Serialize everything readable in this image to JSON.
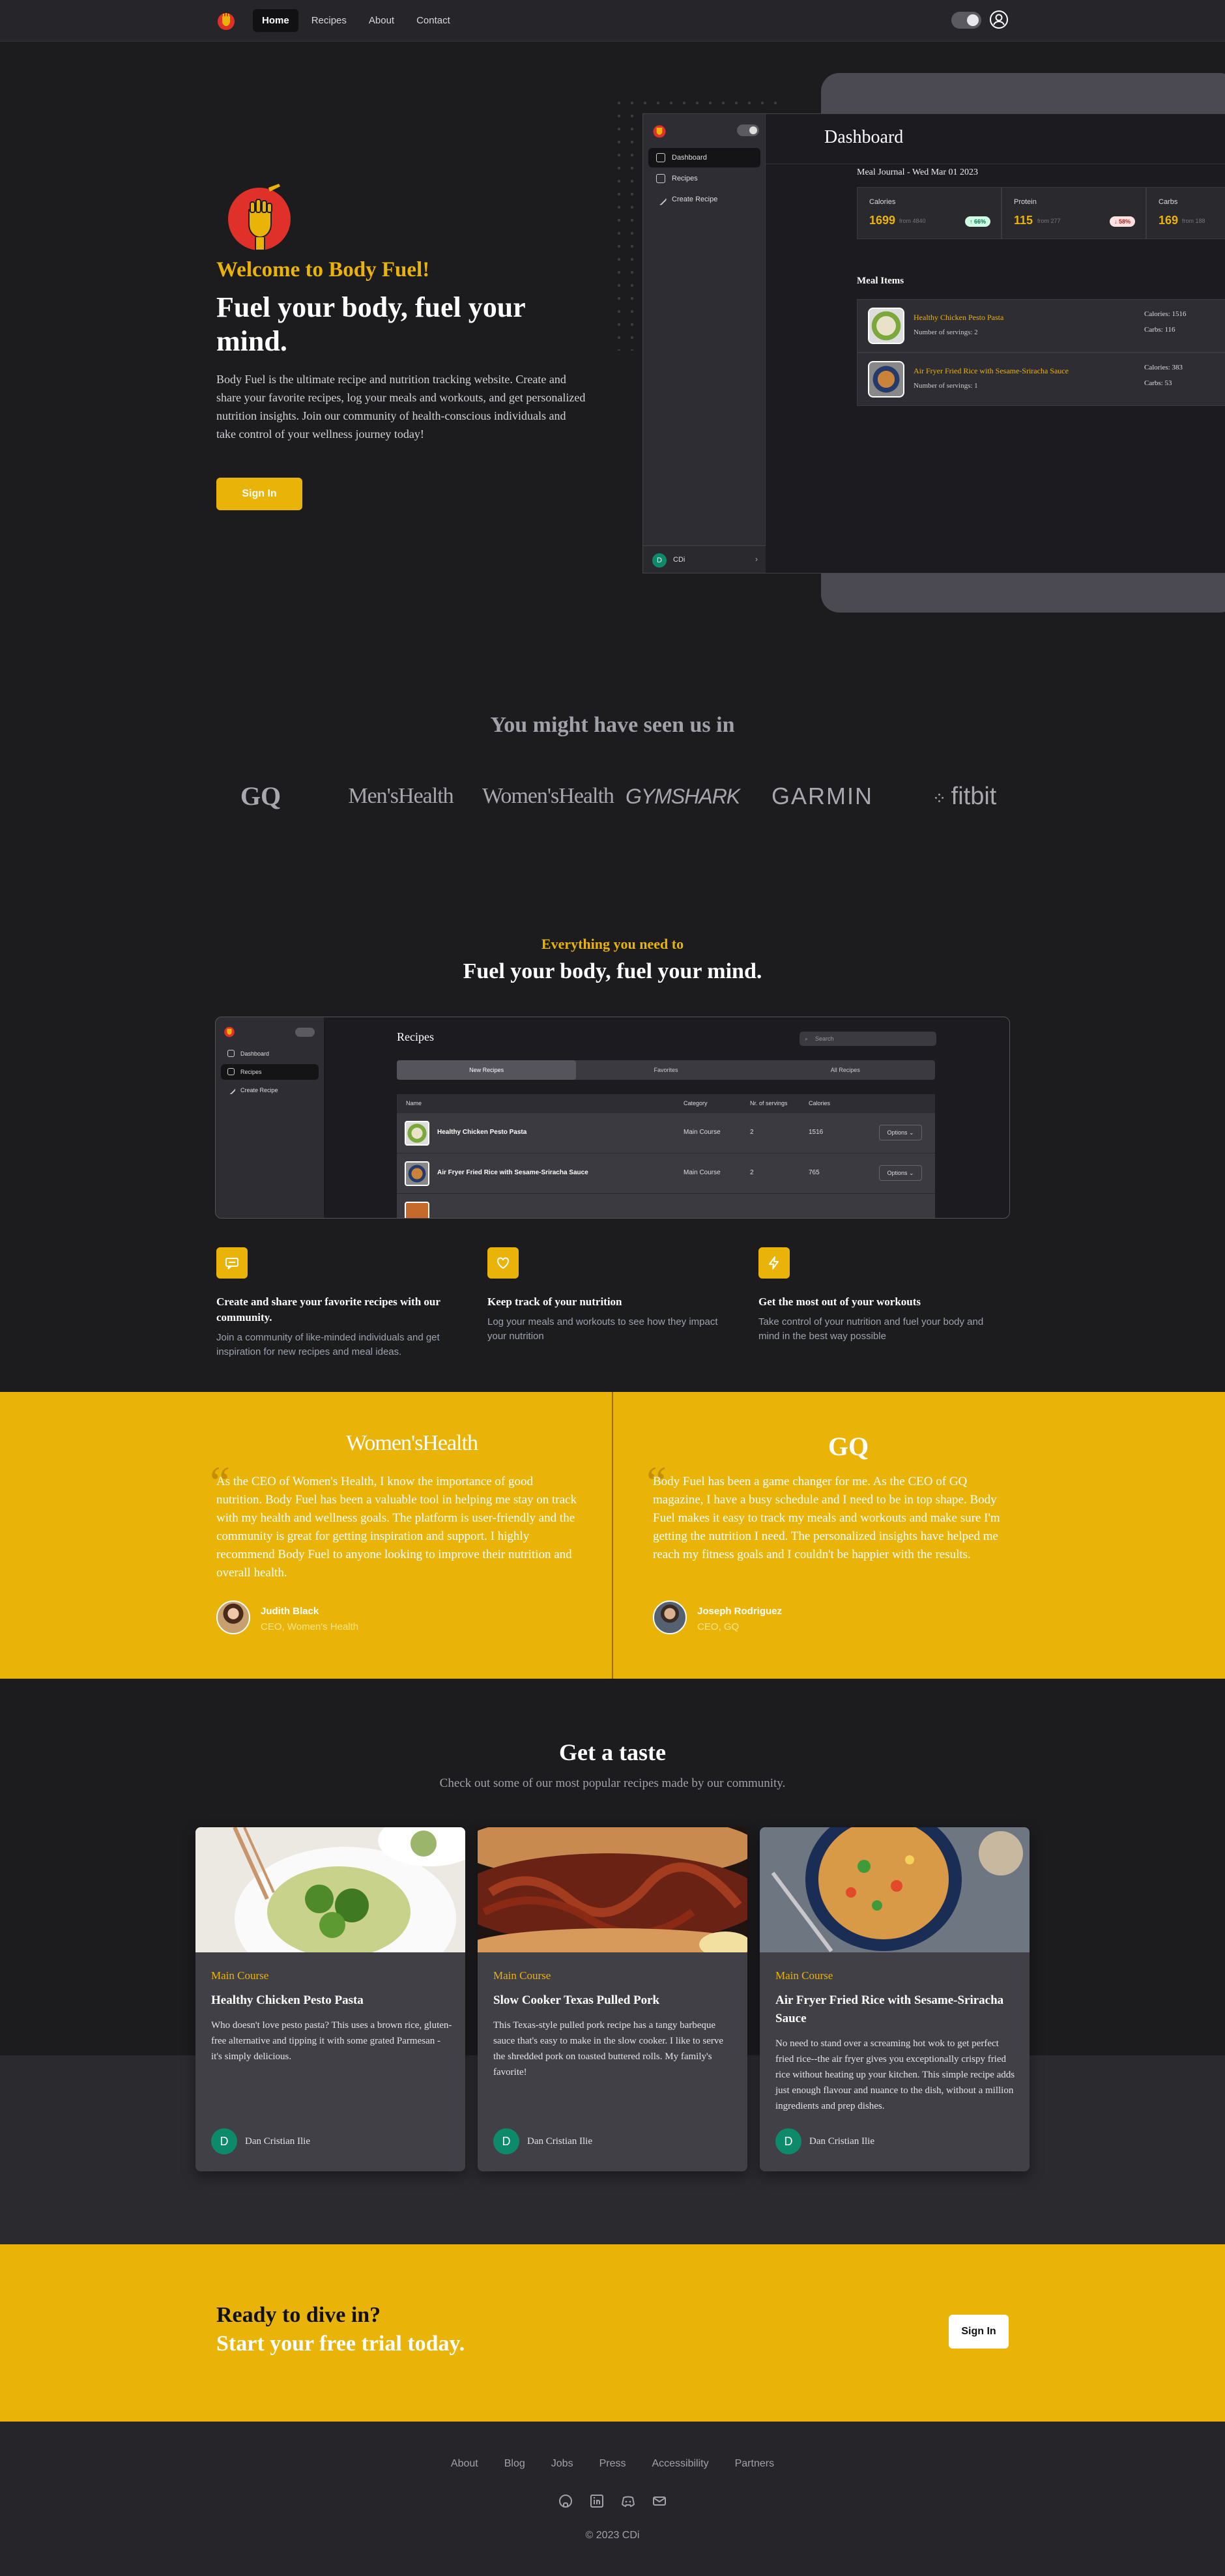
{
  "nav": {
    "links": [
      "Home",
      "Recipes",
      "About",
      "Contact"
    ]
  },
  "hero": {
    "kicker": "Welcome to Body Fuel!",
    "title": "Fuel your body, fuel your mind.",
    "text": "Body Fuel is the ultimate recipe and nutrition tracking website. Create and share your favorite recipes, log your meals and workouts, and get personalized nutrition insights. Join our community of health-conscious individuals and take control of your wellness journey today!",
    "button": "Sign In"
  },
  "dashboard_mock": {
    "sidebar": [
      "Dashboard",
      "Recipes",
      "Create Recipe"
    ],
    "user": "CDi",
    "title": "Dashboard",
    "journal": "Meal Journal - Wed Mar 01 2023",
    "stats": [
      {
        "label": "Calories",
        "value": "1699",
        "from": "from 4840",
        "badge": "↑ 66%",
        "trend": "up"
      },
      {
        "label": "Protein",
        "value": "115",
        "from": "from 277",
        "badge": "↓ 58%",
        "trend": "down"
      },
      {
        "label": "Carbs",
        "value": "169",
        "from": "from 188",
        "badge": "",
        "trend": "up"
      }
    ],
    "meal_heading": "Meal Items",
    "meals": [
      {
        "title": "Healthy Chicken Pesto Pasta",
        "servings": "Number of servings: 2",
        "calories": "Calories: 1516",
        "carbs": "Carbs: 116"
      },
      {
        "title": "Air Fryer Fried Rice with Sesame-Sriracha Sauce",
        "servings": "Number of servings: 1",
        "calories": "Calories: 383",
        "carbs": "Carbs: 53"
      }
    ]
  },
  "seen": {
    "title": "You might have seen us in",
    "brands": [
      "GQ",
      "Men'sHealth",
      "Women'sHealth",
      "GYMSHARK",
      "GARMIN",
      "fitbit"
    ]
  },
  "features": {
    "kicker": "Everything you need to",
    "title": "Fuel your body, fuel your mind.",
    "mock": {
      "sidebar": [
        "Dashboard",
        "Recipes",
        "Create Recipe"
      ],
      "title": "Recipes",
      "search": "Search",
      "tabs": [
        "New Recipes",
        "Favorites",
        "All Recipes"
      ],
      "headers": [
        "Name",
        "Category",
        "Nr. of servings",
        "Calories"
      ],
      "rows": [
        {
          "name": "Healthy Chicken Pesto Pasta",
          "category": "Main Course",
          "servings": "2",
          "calories": "1516",
          "options": "Options"
        },
        {
          "name": "Air Fryer Fried Rice with Sesame-Sriracha Sauce",
          "category": "Main Course",
          "servings": "2",
          "calories": "765",
          "options": "Options"
        }
      ]
    },
    "cards": [
      {
        "title": "Create and share your favorite recipes with our community.",
        "text": "Join a community of like-minded individuals and get inspiration for new recipes and meal ideas."
      },
      {
        "title": "Keep track of your nutrition",
        "text": "Log your meals and workouts to see how they impact your nutrition"
      },
      {
        "title": "Get the most out of your workouts",
        "text": "Take control of your nutrition and fuel your body and mind in the best way possible"
      }
    ]
  },
  "testimonials": [
    {
      "brand": "Women'sHealth",
      "quote": "As the CEO of Women's Health, I know the importance of good nutrition. Body Fuel has been a valuable tool in helping me stay on track with my health and wellness goals. The platform is user-friendly and the community is great for getting inspiration and support. I highly recommend Body Fuel to anyone looking to improve their nutrition and overall health.",
      "name": "Judith Black",
      "role": "CEO, Women's Health"
    },
    {
      "brand": "GQ",
      "quote": "Body Fuel has been a game changer for me. As the CEO of GQ magazine, I have a busy schedule and I need to be in top shape. Body Fuel makes it easy to track my meals and workouts and make sure I'm getting the nutrition I need. The personalized insights have helped me reach my fitness goals and I couldn't be happier with the results.",
      "name": "Joseph Rodriguez",
      "role": "CEO, GQ"
    }
  ],
  "taste": {
    "title": "Get a taste",
    "subtitle": "Check out some of our most popular recipes made by our community.",
    "recipes": [
      {
        "category": "Main Course",
        "title": "Healthy Chicken Pesto Pasta",
        "description": "Who doesn't love pesto pasta? This uses a brown rice, gluten-free alternative and tipping it with some grated Parmesan - it's simply delicious.",
        "author_initial": "D",
        "author": "Dan Cristian Ilie"
      },
      {
        "category": "Main Course",
        "title": "Slow Cooker Texas Pulled Pork",
        "description": "This Texas-style pulled pork recipe has a tangy barbeque sauce that's easy to make in the slow cooker. I like to serve the shredded pork on toasted buttered rolls. My family's favorite!",
        "author_initial": "D",
        "author": "Dan Cristian Ilie"
      },
      {
        "category": "Main Course",
        "title": "Air Fryer Fried Rice with Sesame-Sriracha Sauce",
        "description": "No need to stand over a screaming hot wok to get perfect fried rice--the air fryer gives you exceptionally crispy fried rice without heating up your kitchen. This simple recipe adds just enough flavour and nuance to the dish, without a million ingredients and prep dishes.",
        "author_initial": "D",
        "author": "Dan Cristian Ilie"
      }
    ]
  },
  "cta": {
    "line1": "Ready to dive in?",
    "line2": "Start your free trial today.",
    "button": "Sign In"
  },
  "footer": {
    "links": [
      "About",
      "Blog",
      "Jobs",
      "Press",
      "Accessibility",
      "Partners"
    ],
    "social_icons": [
      "github-icon",
      "linkedin-icon",
      "discord-icon",
      "mail-icon"
    ],
    "copyright": "© 2023 CDi"
  },
  "colors": {
    "accent": "#eab308",
    "background": "#1c1b1e",
    "card": "#404046",
    "avatar": "#0d8a6a"
  }
}
